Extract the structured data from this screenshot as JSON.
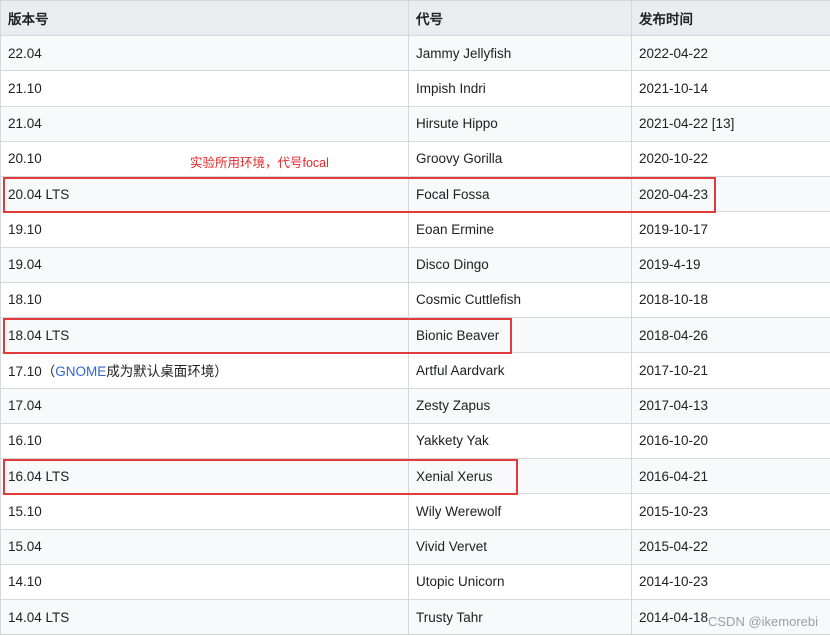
{
  "table": {
    "headers": [
      "版本号",
      "代号",
      "发布时间"
    ],
    "rows": [
      {
        "version": "22.04",
        "codename": "Jammy Jellyfish",
        "date": "2022-04-22"
      },
      {
        "version": "21.10",
        "codename": "Impish Indri",
        "date": "2021-10-14"
      },
      {
        "version": "21.04",
        "codename": "Hirsute Hippo",
        "date": "2021-04-22 [13]"
      },
      {
        "version": "20.10",
        "codename": "Groovy Gorilla",
        "date": "2020-10-22"
      },
      {
        "version": "20.04 LTS",
        "codename": "Focal Fossa",
        "date": "2020-04-23"
      },
      {
        "version": "19.10",
        "codename": "Eoan Ermine",
        "date": "2019-10-17"
      },
      {
        "version": "19.04",
        "codename": "Disco Dingo",
        "date": "2019-4-19"
      },
      {
        "version": "18.10",
        "codename": "Cosmic Cuttlefish",
        "date": "2018-10-18"
      },
      {
        "version": "18.04 LTS",
        "codename": "Bionic Beaver",
        "date": "2018-04-26"
      },
      {
        "version_prefix": "17.10（",
        "version_link": "GNOME",
        "version_suffix": "成为默认桌面环境）",
        "codename": "Artful Aardvark",
        "date": "2017-10-21"
      },
      {
        "version": "17.04",
        "codename": "Zesty Zapus",
        "date": "2017-04-13"
      },
      {
        "version": "16.10",
        "codename": "Yakkety Yak",
        "date": "2016-10-20"
      },
      {
        "version": "16.04 LTS",
        "codename": "Xenial Xerus",
        "date": "2016-04-21"
      },
      {
        "version": "15.10",
        "codename": "Wily Werewolf",
        "date": "2015-10-23"
      },
      {
        "version": "15.04",
        "codename": "Vivid Vervet",
        "date": "2015-04-22"
      },
      {
        "version": "14.10",
        "codename": "Utopic Unicorn",
        "date": "2014-10-23"
      },
      {
        "version": "14.04 LTS",
        "codename": "Trusty Tahr",
        "date": "2014-04-18"
      }
    ]
  },
  "annotation": "实验所用环境，代号focal",
  "watermark": "CSDN @ikemorebi",
  "colors": {
    "header_bg": "#eaecf0",
    "stripe_bg": "#f8f9fa",
    "highlight": "#e23b3b",
    "link": "#3366cc"
  }
}
